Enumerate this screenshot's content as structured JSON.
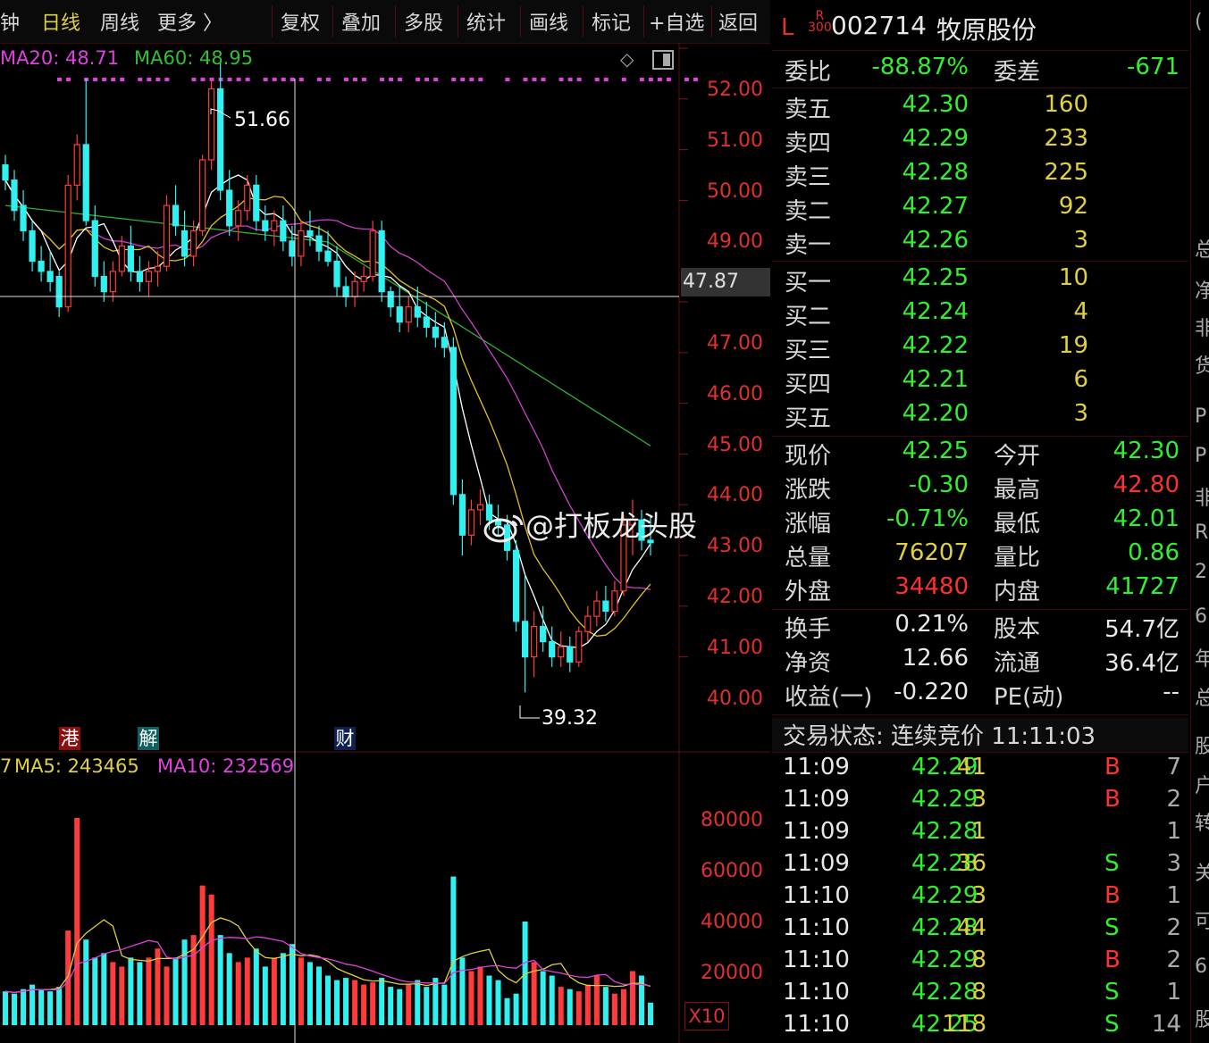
{
  "toolbar": {
    "items": [
      "钟",
      "日线",
      "周线",
      "更多 〉",
      "复权",
      "叠加",
      "多股",
      "统计",
      "画线",
      "标记",
      "+自选",
      "返回"
    ],
    "active": "日线"
  },
  "chart": {
    "ma_legend": [
      {
        "label": "MA20: 48.71",
        "color": "#e040e0"
      },
      {
        "label": "MA60: 48.95",
        "color": "#30c030"
      }
    ],
    "price_axis": [
      "52.00",
      "51.00",
      "50.00",
      "49.00",
      "47.00",
      "46.00",
      "45.00",
      "44.00",
      "43.00",
      "42.00",
      "41.00",
      "40.00"
    ],
    "cursor_price": "47.87",
    "high_label": "51.66",
    "low_label": "39.32",
    "markers": [
      {
        "text": "港",
        "bg": "#8a1010"
      },
      {
        "text": "解",
        "bg": "#106060"
      },
      {
        "text": "财",
        "bg": "#102050"
      }
    ],
    "watermark": "@打板龙头股",
    "vol_legend": [
      {
        "label": "7",
        "color": "#e0d040"
      },
      {
        "label": "MA5: 243465",
        "color": "#e0d040"
      },
      {
        "label": "MA10: 232569",
        "color": "#e040e0"
      }
    ],
    "vol_axis": [
      "80000",
      "60000",
      "40000",
      "20000"
    ],
    "vol_unit": "X10",
    "colors": {
      "up": "#ff3b3b",
      "down": "#30f0f0",
      "ma5": "#ffffff",
      "ma10": "#e0c020",
      "ma20": "#d040d0",
      "ma60": "#30b030"
    }
  },
  "chart_data": {
    "type": "candlestick",
    "title": "",
    "ylim": [
      39.0,
      52.5
    ],
    "candles": [
      [
        49.7,
        49.9,
        49.2,
        49.4
      ],
      [
        49.4,
        49.6,
        48.6,
        48.8
      ],
      [
        48.9,
        49.2,
        48.2,
        48.4
      ],
      [
        48.4,
        48.6,
        47.6,
        47.8
      ],
      [
        47.8,
        48.1,
        47.4,
        47.6
      ],
      [
        47.6,
        48.0,
        47.2,
        47.4
      ],
      [
        47.5,
        47.6,
        46.7,
        46.9
      ],
      [
        46.9,
        49.5,
        46.8,
        49.3
      ],
      [
        49.3,
        50.3,
        49.0,
        50.1
      ],
      [
        50.1,
        51.4,
        48.5,
        48.6
      ],
      [
        48.6,
        48.9,
        47.3,
        47.5
      ],
      [
        47.5,
        47.8,
        47.0,
        47.2
      ],
      [
        47.2,
        47.8,
        47.0,
        47.6
      ],
      [
        47.6,
        48.3,
        47.5,
        48.1
      ],
      [
        48.1,
        48.5,
        47.4,
        47.6
      ],
      [
        47.6,
        47.9,
        47.2,
        47.4
      ],
      [
        47.4,
        47.8,
        47.1,
        47.6
      ],
      [
        47.6,
        48.0,
        47.3,
        47.7
      ],
      [
        47.7,
        49.1,
        47.6,
        48.9
      ],
      [
        48.9,
        49.3,
        48.3,
        48.5
      ],
      [
        48.4,
        48.8,
        47.7,
        47.9
      ],
      [
        47.9,
        48.6,
        47.7,
        48.4
      ],
      [
        48.4,
        49.9,
        48.3,
        49.8
      ],
      [
        49.8,
        51.4,
        49.6,
        51.2
      ],
      [
        51.2,
        51.7,
        49.0,
        49.2
      ],
      [
        49.2,
        49.6,
        48.3,
        48.5
      ],
      [
        48.5,
        49.0,
        48.2,
        48.8
      ],
      [
        48.8,
        49.5,
        48.6,
        49.3
      ],
      [
        49.3,
        49.5,
        48.4,
        48.6
      ],
      [
        48.6,
        48.9,
        48.2,
        48.4
      ],
      [
        48.4,
        48.8,
        48.1,
        48.6
      ],
      [
        48.6,
        48.9,
        48.0,
        48.2
      ],
      [
        48.2,
        48.5,
        47.7,
        47.9
      ],
      [
        47.9,
        48.6,
        47.7,
        48.4
      ],
      [
        48.4,
        48.8,
        48.1,
        48.3
      ],
      [
        48.3,
        48.5,
        47.8,
        48.0
      ],
      [
        48.0,
        48.4,
        47.7,
        47.8
      ],
      [
        47.8,
        48.1,
        47.1,
        47.3
      ],
      [
        47.3,
        47.5,
        46.9,
        47.1
      ],
      [
        47.1,
        47.6,
        46.9,
        47.4
      ],
      [
        47.4,
        47.7,
        47.2,
        47.5
      ],
      [
        47.5,
        48.6,
        47.4,
        48.4
      ],
      [
        48.4,
        48.6,
        47.0,
        47.2
      ],
      [
        47.2,
        47.3,
        46.7,
        46.9
      ],
      [
        46.9,
        47.3,
        46.4,
        46.6
      ],
      [
        46.6,
        47.1,
        46.4,
        46.9
      ],
      [
        46.9,
        47.3,
        46.5,
        46.7
      ],
      [
        46.7,
        47.0,
        46.3,
        46.5
      ],
      [
        46.5,
        46.8,
        46.1,
        46.3
      ],
      [
        46.3,
        46.6,
        45.9,
        46.1
      ],
      [
        46.1,
        46.3,
        43.0,
        43.2
      ],
      [
        43.2,
        43.5,
        42.0,
        42.4
      ],
      [
        42.4,
        43.1,
        42.2,
        42.9
      ],
      [
        42.9,
        43.3,
        42.6,
        43.0
      ],
      [
        43.0,
        43.2,
        42.5,
        42.7
      ],
      [
        42.7,
        43.0,
        42.4,
        42.6
      ],
      [
        42.6,
        42.8,
        41.9,
        42.1
      ],
      [
        42.1,
        42.3,
        40.5,
        40.7
      ],
      [
        40.7,
        41.6,
        39.3,
        40.0
      ],
      [
        40.0,
        40.9,
        39.6,
        40.6
      ],
      [
        40.6,
        41.0,
        40.1,
        40.3
      ],
      [
        40.3,
        40.6,
        39.8,
        40.0
      ],
      [
        40.0,
        40.5,
        39.8,
        40.2
      ],
      [
        40.2,
        40.4,
        39.7,
        39.9
      ],
      [
        39.9,
        40.6,
        39.8,
        40.5
      ],
      [
        40.5,
        41.0,
        40.3,
        40.8
      ],
      [
        40.8,
        41.3,
        40.6,
        41.1
      ],
      [
        41.1,
        41.4,
        40.7,
        40.9
      ],
      [
        40.9,
        41.5,
        40.8,
        41.3
      ],
      [
        41.3,
        42.8,
        41.2,
        42.6
      ],
      [
        42.6,
        43.1,
        42.0,
        42.7
      ],
      [
        42.7,
        42.9,
        42.1,
        42.3
      ],
      [
        42.3,
        42.8,
        42.0,
        42.25
      ]
    ],
    "volume": [
      15000,
      14000,
      16000,
      18000,
      16000,
      15000,
      17000,
      42000,
      92000,
      38000,
      30000,
      32000,
      28000,
      26000,
      30000,
      28000,
      30000,
      34000,
      26000,
      30000,
      38000,
      40000,
      62000,
      58000,
      40000,
      32000,
      28000,
      30000,
      34000,
      26000,
      30000,
      32000,
      36000,
      30000,
      28000,
      26000,
      22000,
      20000,
      21000,
      20000,
      18000,
      19000,
      21000,
      17000,
      16000,
      18000,
      20000,
      17000,
      21000,
      18000,
      66000,
      30000,
      24000,
      26000,
      22000,
      20000,
      12000,
      14000,
      46000,
      28000,
      24000,
      22000,
      17000,
      16000,
      15000,
      18000,
      22000,
      17000,
      14000,
      16000,
      24000,
      22000,
      10000
    ]
  }
}
